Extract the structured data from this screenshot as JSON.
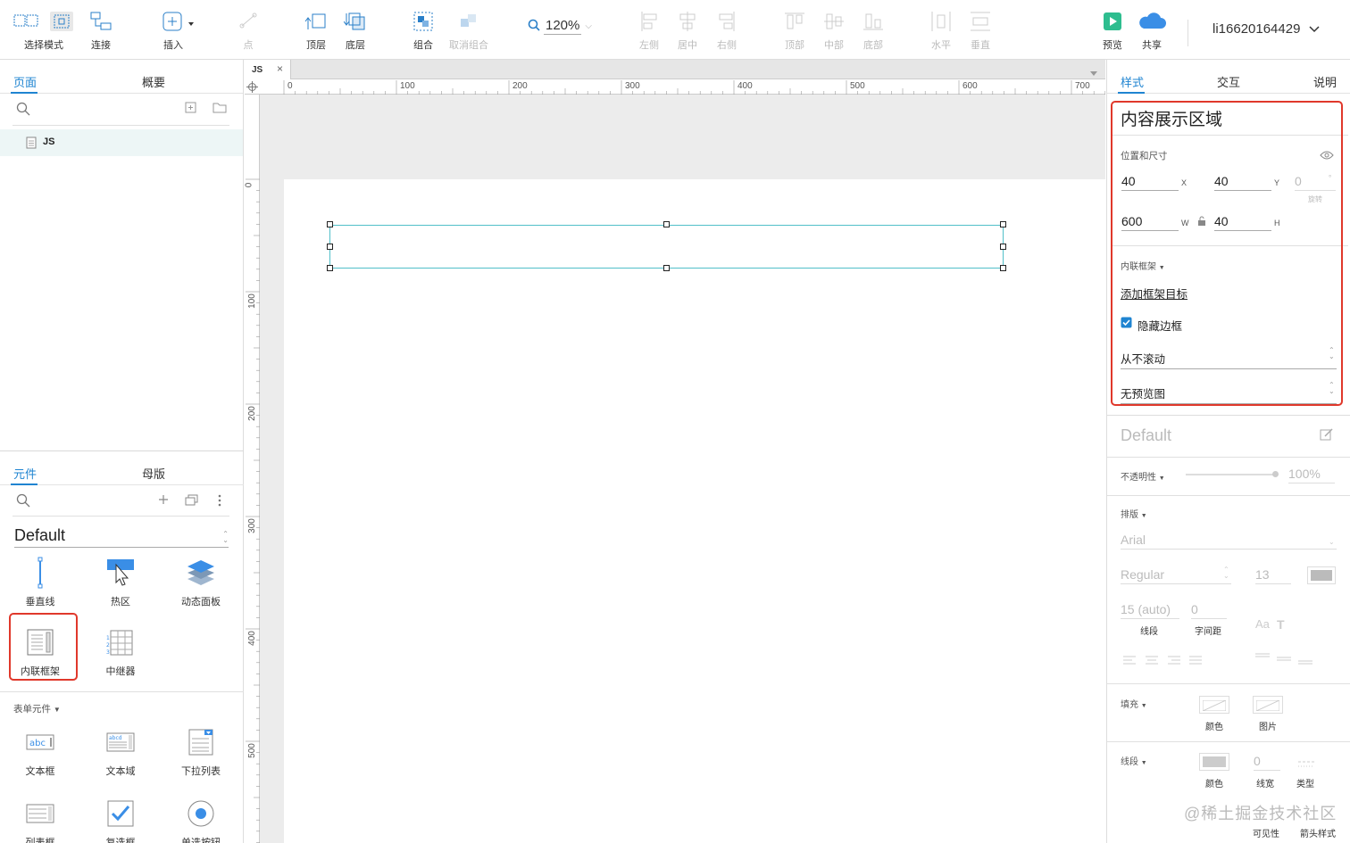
{
  "toolbar": {
    "select_mode": "选择模式",
    "connect": "连接",
    "insert": "插入",
    "point": "点",
    "top_layer": "顶层",
    "bottom_layer": "底层",
    "group": "组合",
    "ungroup": "取消组合",
    "zoom": "120%",
    "align_left": "左侧",
    "align_center": "居中",
    "align_right": "右侧",
    "align_top": "顶部",
    "align_middle": "中部",
    "align_bottom": "底部",
    "distribute_h": "水平",
    "distribute_v": "垂直",
    "preview": "预览",
    "share": "共享",
    "user": "li16620164429",
    "accent": "#1f84d1",
    "preview_color": "#2ebd8f",
    "share_color": "#3a8ee6"
  },
  "pages_panel": {
    "tab_pages": "页面",
    "tab_outline": "概要",
    "page_name": "JS"
  },
  "widgets_panel": {
    "tab_widgets": "元件",
    "tab_masters": "母版",
    "library": "Default",
    "items": [
      {
        "label": "垂直线",
        "icon": "vertical-line-icon"
      },
      {
        "label": "热区",
        "icon": "hotspot-icon"
      },
      {
        "label": "动态面板",
        "icon": "dynamic-panel-icon"
      },
      {
        "label": "内联框架",
        "icon": "inline-frame-icon"
      },
      {
        "label": "中继器",
        "icon": "repeater-icon"
      }
    ],
    "form_section": "表单元件",
    "form_items": [
      {
        "label": "文本框",
        "icon": "textbox-icon"
      },
      {
        "label": "文本域",
        "icon": "textarea-icon"
      },
      {
        "label": "下拉列表",
        "icon": "dropdown-icon"
      },
      {
        "label": "列表框",
        "icon": "listbox-icon"
      },
      {
        "label": "复选框",
        "icon": "checkbox-icon"
      },
      {
        "label": "单选按钮",
        "icon": "radio-icon"
      }
    ]
  },
  "canvas": {
    "doc_tab": "JS",
    "ruler_h": [
      "0",
      "100",
      "200",
      "300",
      "400",
      "500",
      "600",
      "700"
    ],
    "ruler_v": [
      "0",
      "100",
      "200",
      "300",
      "400",
      "500"
    ]
  },
  "inspector": {
    "tab_style": "样式",
    "tab_interact": "交互",
    "tab_notes": "说明",
    "title": "内容展示区域",
    "pos_size_label": "位置和尺寸",
    "x": "40",
    "x_label": "X",
    "y": "40",
    "y_label": "Y",
    "rotation": "0",
    "rotation_label": "旋转",
    "w": "600",
    "w_label": "W",
    "h": "40",
    "h_label": "H",
    "inline_frame_label": "内联框架",
    "add_target": "添加框架目标",
    "hide_border": "隐藏边框",
    "hide_border_checked": true,
    "scroll": "从不滚动",
    "preview_img": "无预览图",
    "style_name": "Default",
    "opacity_label": "不透明性",
    "opacity_value": "100%",
    "typography_label": "排版",
    "font": "Arial",
    "font_style": "Regular",
    "font_size": "13",
    "line_height": "15 (auto)",
    "line_label": "线段",
    "letter_spacing": "0",
    "letter_label": "字间距",
    "fill_label": "填充",
    "fill_color": "颜色",
    "fill_image": "图片",
    "stroke_label": "线段",
    "stroke_color": "颜色",
    "stroke_width": "0",
    "stroke_width_label": "线宽",
    "stroke_type": "类型",
    "visibility": "可见性",
    "arrow_style": "箭头样式"
  },
  "watermark": "@稀土掘金技术社区"
}
